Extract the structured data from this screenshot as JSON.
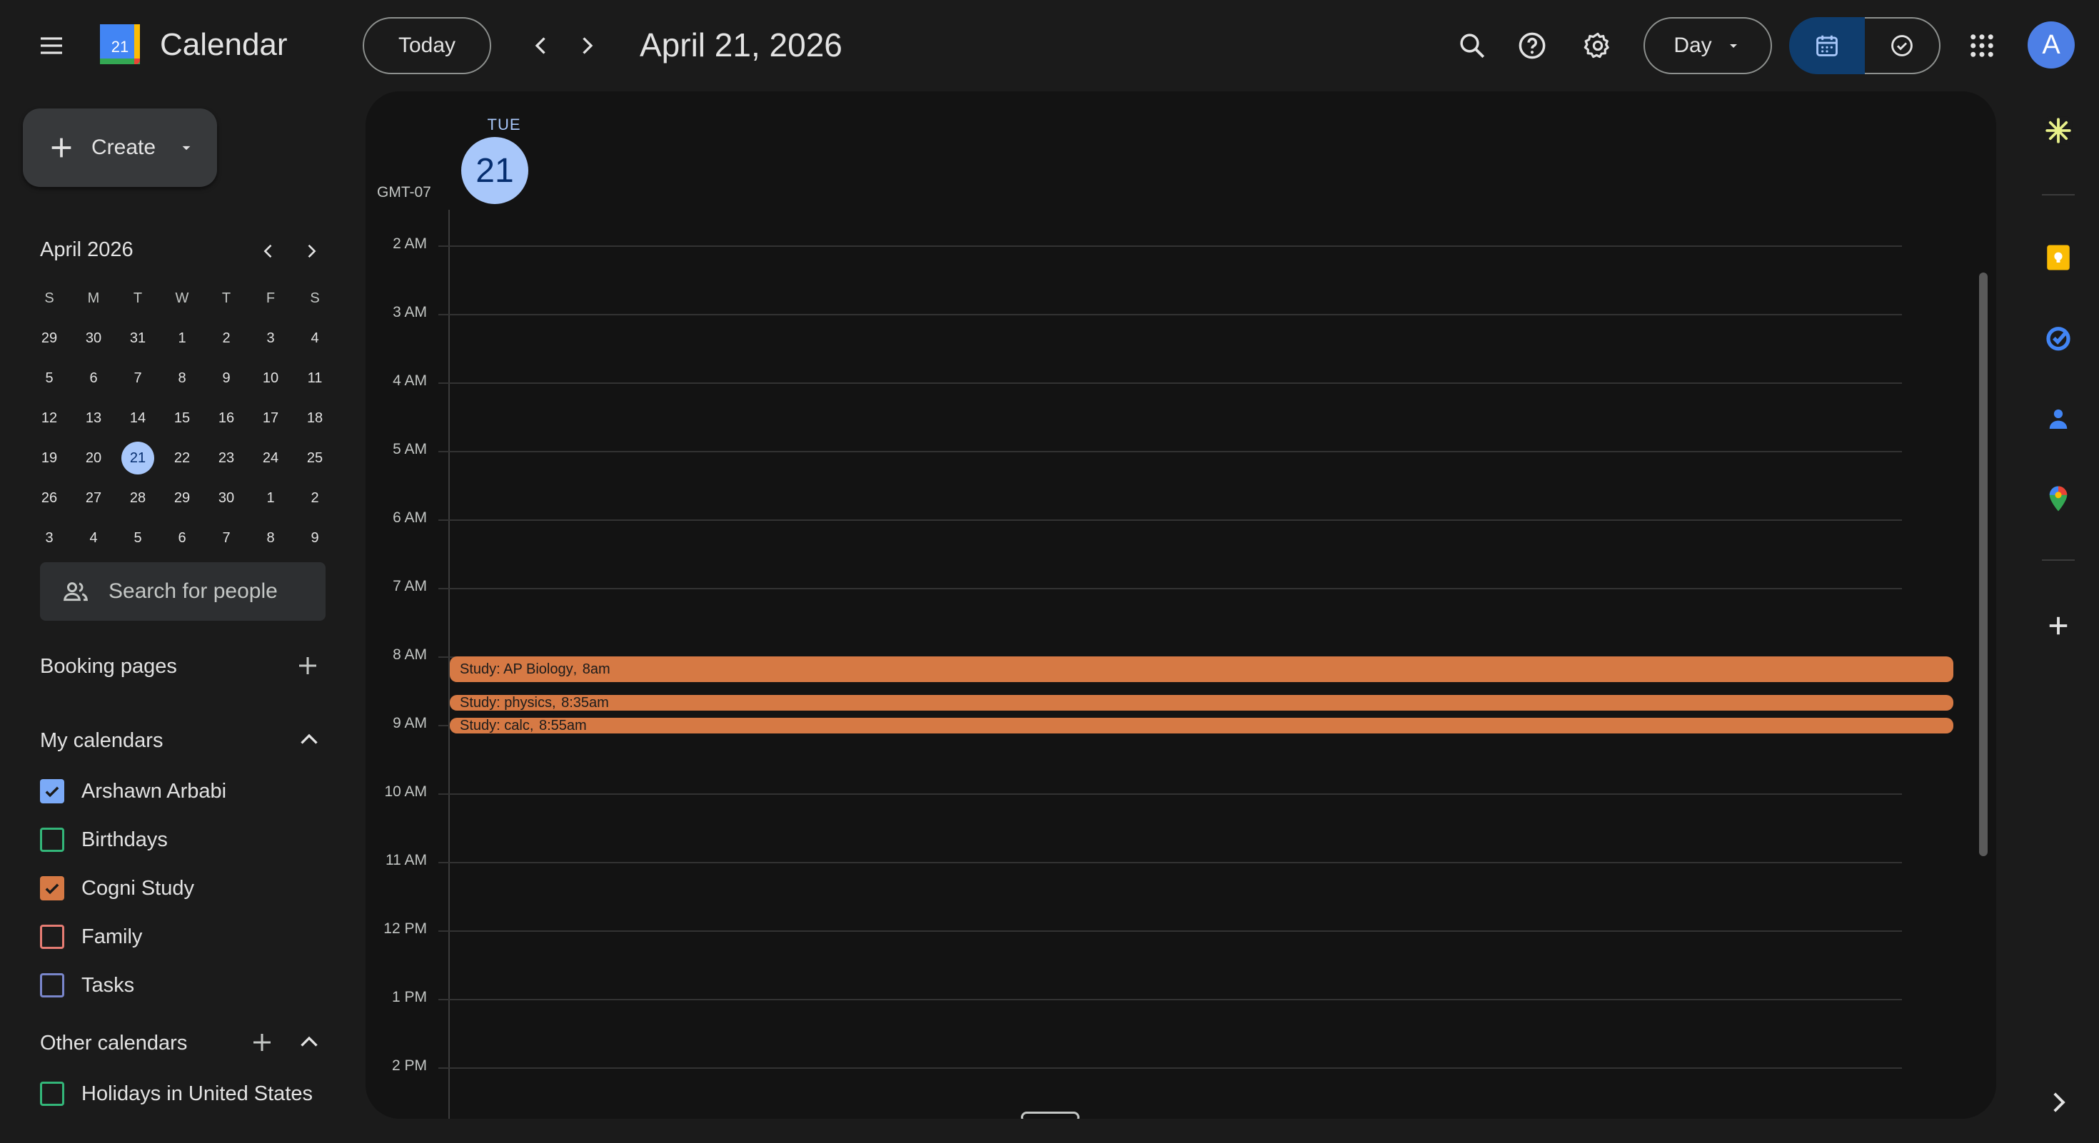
{
  "header": {
    "app_title": "Calendar",
    "logo_day": "21",
    "today_label": "Today",
    "date_title": "April 21, 2026",
    "view_label": "Day",
    "avatar_initial": "A"
  },
  "sidebar": {
    "create_label": "Create",
    "mini_calendar": {
      "month_label": "April 2026",
      "weekdays": [
        "S",
        "M",
        "T",
        "W",
        "T",
        "F",
        "S"
      ],
      "weeks": [
        [
          "29",
          "30",
          "31",
          "1",
          "2",
          "3",
          "4"
        ],
        [
          "5",
          "6",
          "7",
          "8",
          "9",
          "10",
          "11"
        ],
        [
          "12",
          "13",
          "14",
          "15",
          "16",
          "17",
          "18"
        ],
        [
          "19",
          "20",
          "21",
          "22",
          "23",
          "24",
          "25"
        ],
        [
          "26",
          "27",
          "28",
          "29",
          "30",
          "1",
          "2"
        ],
        [
          "3",
          "4",
          "5",
          "6",
          "7",
          "8",
          "9"
        ]
      ],
      "selected": "21"
    },
    "people_search_placeholder": "Search for people",
    "booking_pages_label": "Booking pages",
    "my_calendars_label": "My calendars",
    "my_calendars": [
      {
        "name": "Arshawn Arbabi",
        "checked": true,
        "color": "#7baaf7"
      },
      {
        "name": "Birthdays",
        "checked": false,
        "color": "#33b679"
      },
      {
        "name": "Cogni Study",
        "checked": true,
        "color": "#d67944"
      },
      {
        "name": "Family",
        "checked": false,
        "color": "#e67c73"
      },
      {
        "name": "Tasks",
        "checked": false,
        "color": "#7986cb"
      }
    ],
    "other_calendars_label": "Other calendars",
    "other_calendars": [
      {
        "name": "Holidays in United States",
        "checked": false,
        "color": "#33b679"
      }
    ]
  },
  "day_view": {
    "day_of_week": "TUE",
    "day_number": "21",
    "timezone": "GMT-07",
    "hours": [
      "2 AM",
      "3 AM",
      "4 AM",
      "5 AM",
      "6 AM",
      "7 AM",
      "8 AM",
      "9 AM",
      "10 AM",
      "11 AM",
      "12 PM",
      "1 PM",
      "2 PM"
    ],
    "events": [
      {
        "title": "Study: AP Biology",
        "time": "8am"
      },
      {
        "title": "Study: physics",
        "time": "8:35am"
      },
      {
        "title": "Study: calc",
        "time": "8:55am"
      }
    ]
  },
  "colors": {
    "accent": "#a8c7fa",
    "event": "#d67944",
    "selected_view": "#0f3d6e"
  }
}
